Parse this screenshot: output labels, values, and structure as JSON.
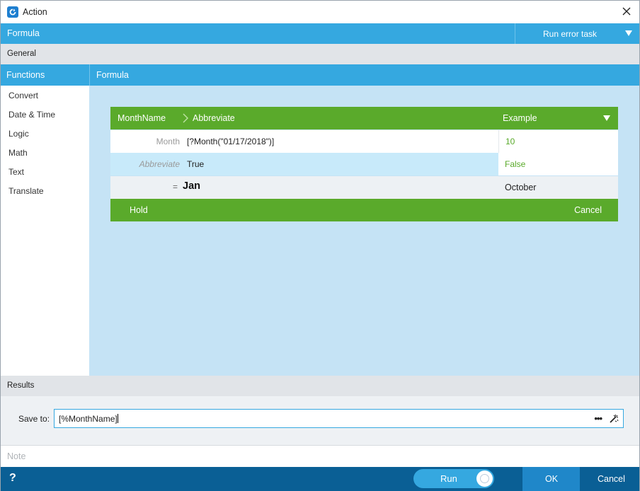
{
  "window": {
    "title": "Action",
    "icon": "app-logo-icon",
    "close_icon": "close-icon"
  },
  "formula_bar": {
    "label": "Formula",
    "run_error_task": "Run error task"
  },
  "general": {
    "label": "General"
  },
  "functions": {
    "header": "Functions",
    "items": [
      "Convert",
      "Date & Time",
      "Logic",
      "Math",
      "Text",
      "Translate"
    ]
  },
  "formula_panel": {
    "header": "Formula",
    "card": {
      "function_name": "MonthName",
      "parameter": "Abbreviate",
      "example_label": "Example",
      "rows": [
        {
          "label": "Month",
          "value": "[?Month(\"01/17/2018\")]",
          "example": "10"
        },
        {
          "label": "Abbreviate",
          "value": "True",
          "example": "False"
        }
      ],
      "result": {
        "equals": "=",
        "value": "Jan",
        "example": "October"
      },
      "hold": "Hold",
      "cancel": "Cancel"
    }
  },
  "results": {
    "label": "Results",
    "save_to_label": "Save to:",
    "save_to_value": "[%MonthName]",
    "more_icon": "ellipsis-icon",
    "wand_icon": "magic-wand-icon"
  },
  "note": {
    "placeholder": "Note"
  },
  "bottom": {
    "help": "?",
    "run": "Run",
    "ok": "OK",
    "cancel": "Cancel"
  },
  "colors": {
    "header_blue": "#35a8e0",
    "green": "#5aaa2b",
    "formula_bg": "#c5e3f5",
    "bottom_bar": "#0a5f95",
    "ok_button": "#1f87c9"
  }
}
